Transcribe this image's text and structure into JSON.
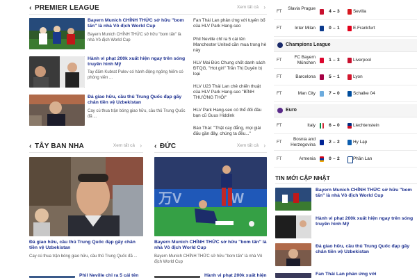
{
  "premier_league": {
    "title": "PREMIER LEAGUE",
    "more": "Xem tất cả",
    "items": [
      {
        "title": "Bayern Munich CHÍNH THỨC sở hữu \"bom tấn\" là nhà Vô địch World Cup",
        "sapo": "Bayern Munich CHÍNH THỨC sở hữu \"bom tấn\" là nhà Vô địch World Cup"
      },
      {
        "title": "Hành vi phạt 200k xuất hiện ngay trên sóng truyền hình Mỹ",
        "sapo": "Tay đấm Kubrat Pulev có hành động ngông hiếm có phóng viên ..."
      },
      {
        "title": "Đá giao hữu, cầu thủ Trung Quốc đạp gãy chân tiền vệ Uzbekistan",
        "sapo": "Cay cú thua trận bóng giao hữu, cầu thủ Trung Quốc đã ..."
      }
    ],
    "list": [
      "Fan Thái Lan phản ứng với tuyên bố của HLV Park Hang-seo",
      "Phil Neville chỉ ra 5 cái tên Manchester United cần mua trong hè này",
      "HLV Mai Đức Chung chốt danh sách ĐTQG, \"Hot girl\" Trần Thị Duyên bị loại",
      "HLV U23 Thái Lan chê chiến thuật của HLV Park Hang-seo \"BÌNH THƯỜNG THÔI\"",
      "HLV Park Hang-seo có thể đối đầu bạn cũ Guus Hiddink",
      "Báo Thái: \"Thật cay đắng, mọi giải đấu gần đây, chúng ta đều...\""
    ]
  },
  "spain": {
    "title": "TÂY BAN NHA",
    "more": "Xem tất cả",
    "headline": "Đá giao hữu, cầu thủ Trung Quốc đạp gãy chân tiền vệ Uzbekistan",
    "sapo": "Cay cú thua trận bóng giao hữu, cầu thủ Trung Quốc đã ...",
    "next": "Phil Neville chỉ ra 5 cái tên"
  },
  "germany": {
    "title": "ĐỨC",
    "more": "Xem tất cả",
    "headline": "Bayern Munich CHÍNH THỨC sở hữu \"bom tấn\" là nhà Vô địch World Cup",
    "sapo": "Bayern Munich CHÍNH THỨC sở hữu \"bom tấn\" là nhà Vô địch World Cup",
    "next": "Hành vi phạt 200k xuất hiện"
  },
  "scores": {
    "top_rows": [
      {
        "status": "FT",
        "home": "Slavia Prague",
        "score": "4 – 3",
        "away": "Sevilla"
      },
      {
        "status": "FT",
        "home": "Inter Milan",
        "score": "0 – 1",
        "away": "E.Frankfurt"
      }
    ],
    "champions_league": {
      "name": "Champions League",
      "rows": [
        {
          "status": "FT",
          "home": "FC Bayern München",
          "score": "1 – 3",
          "away": "Liverpool"
        },
        {
          "status": "FT",
          "home": "Barcelona",
          "score": "5 – 1",
          "away": "Lyon"
        },
        {
          "status": "FT",
          "home": "Man City",
          "score": "7 – 0",
          "away": "Schalke 04"
        }
      ]
    },
    "euro": {
      "name": "Euro",
      "rows": [
        {
          "status": "FT",
          "home": "Italy",
          "score": "6 – 0",
          "away": "Liechtenstein"
        },
        {
          "status": "FT",
          "home": "Bosnia and Herzegovina",
          "score": "2 – 2",
          "away": "Hy Lạp"
        },
        {
          "status": "FT",
          "home": "Armenia",
          "score": "0 – 2",
          "away": "Phần Lan"
        }
      ]
    }
  },
  "latest": {
    "title": "TIN MỚI CẬP NHẬT",
    "items": [
      "Bayern Munich CHÍNH THỨC sở hữu \"bom tấn\" là nhà Vô địch World Cup",
      "Hành vi phạt 200k xuất hiện ngay trên sóng truyền hình Mỹ",
      "Đá giao hữu, cầu thủ Trung Quốc đạp gãy chân tiền vệ Uzbekistan",
      "Fan Thái Lan phản ứng với"
    ]
  }
}
